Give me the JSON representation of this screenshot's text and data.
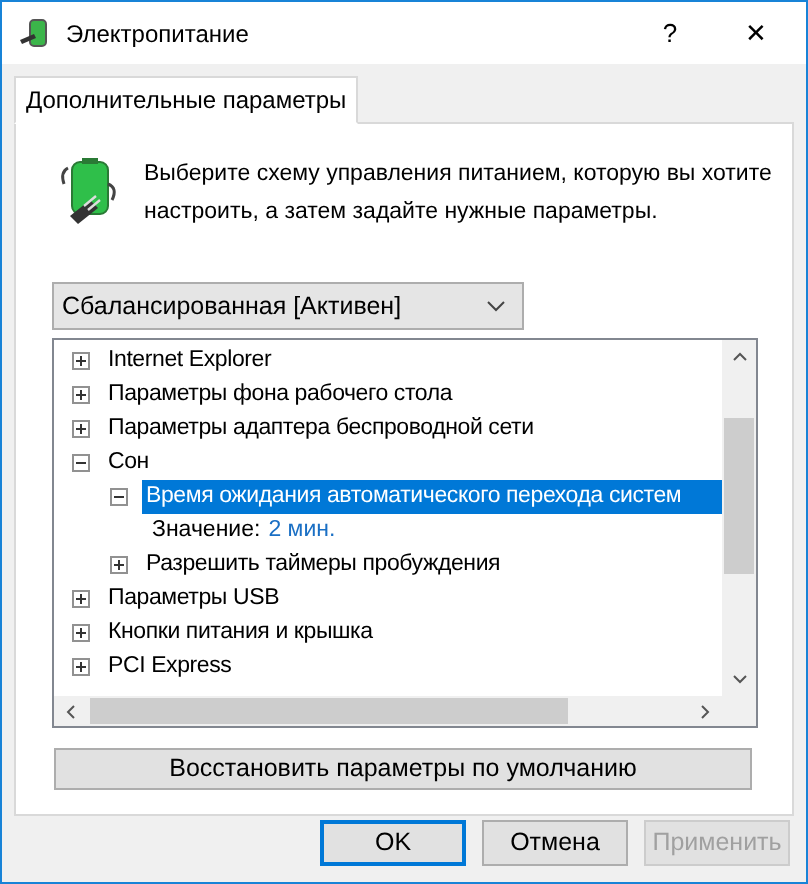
{
  "window": {
    "title": "Электропитание",
    "help": "?",
    "close": "✕"
  },
  "tabs": [
    {
      "label": "Дополнительные параметры",
      "selected": true
    }
  ],
  "description": "Выберите схему управления питанием, которую вы хотите настроить, а затем задайте нужные параметры.",
  "plan_dropdown": {
    "value": "Сбалансированная [Активен]"
  },
  "tree": [
    {
      "kind": "group",
      "label": "Internet Explorer",
      "expanded": false,
      "selected": false
    },
    {
      "kind": "group",
      "label": "Параметры фона рабочего стола",
      "expanded": false,
      "selected": false
    },
    {
      "kind": "group",
      "label": "Параметры адаптера беспроводной сети",
      "expanded": false,
      "selected": false
    },
    {
      "kind": "group",
      "label": "Сон",
      "expanded": true,
      "selected": false,
      "children": [
        {
          "kind": "group",
          "label": "Время ожидания автоматического перехода систем",
          "expanded": true,
          "selected": true,
          "children": [
            {
              "kind": "value",
              "label": "Значение:",
              "value": "2 мин.",
              "selected": false
            }
          ]
        },
        {
          "kind": "group",
          "label": "Разрешить таймеры пробуждения",
          "expanded": false,
          "selected": false
        }
      ]
    },
    {
      "kind": "group",
      "label": "Параметры USB",
      "expanded": false,
      "selected": false
    },
    {
      "kind": "group",
      "label": "Кнопки питания и крышка",
      "expanded": false,
      "selected": false
    },
    {
      "kind": "group",
      "label": "PCI Express",
      "expanded": false,
      "selected": false
    }
  ],
  "restore_button": "Восстановить параметры по умолчанию",
  "buttons": [
    {
      "label": "OK",
      "kind": "default",
      "disabled": false
    },
    {
      "label": "Отмена",
      "kind": "normal",
      "disabled": false
    },
    {
      "label": "Применить",
      "kind": "normal",
      "disabled": true
    }
  ]
}
